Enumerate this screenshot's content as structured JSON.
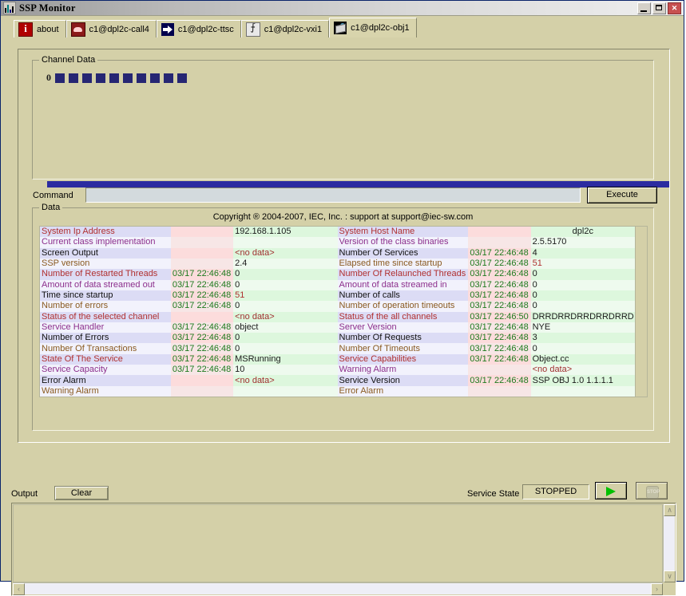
{
  "window": {
    "title": "SSP Monitor",
    "icon": "chart-bars-icon",
    "minimize_label": "",
    "maximize_label": "",
    "close_label": "✕"
  },
  "tabs": [
    {
      "label": "about",
      "icon": "info-icon"
    },
    {
      "label": "c1@dpl2c-call4",
      "icon": "call-icon"
    },
    {
      "label": "c1@dpl2c-ttsc",
      "icon": "arrow-right-icon"
    },
    {
      "label": "c1@dpl2c-vxi1",
      "icon": "vxi-icon"
    },
    {
      "label": "c1@dpl2c-obj1",
      "icon": "object-icon"
    }
  ],
  "selected_tab_index": 4,
  "channel_data": {
    "group_title": "Channel Data",
    "index_label": "0",
    "channel_count": 10,
    "channel_color": "#262673"
  },
  "progress": {
    "percent": 100,
    "fill_color": "#2b2ba0"
  },
  "command": {
    "label": "Command",
    "value": "",
    "placeholder": "",
    "execute_label": "Execute"
  },
  "data_panel": {
    "group_title": "Data",
    "copyright": "Copyright ® 2004-2007, IEC, Inc. : support at support@iec-sw.com"
  },
  "table": {
    "left_rows": [
      {
        "label": "System Ip Address",
        "time": "",
        "value": "192.168.1.105"
      },
      {
        "label": "Current class implementation",
        "time": "",
        "value": ""
      },
      {
        "label": "Screen Output",
        "time": "",
        "value": "<no data>"
      },
      {
        "label": "SSP version",
        "time": "",
        "value": "2.4"
      },
      {
        "label": "Number of Restarted Threads",
        "time": "03/17 22:46:48",
        "value": "0"
      },
      {
        "label": "Amount of data streamed out",
        "time": "03/17 22:46:48",
        "value": "0"
      },
      {
        "label": "Time since startup",
        "time": "03/17 22:46:48",
        "value": "51"
      },
      {
        "label": "Number of errors",
        "time": "03/17 22:46:48",
        "value": "0"
      },
      {
        "label": "Status of the selected channel",
        "time": "",
        "value": "<no data>"
      },
      {
        "label": "Service Handler",
        "time": "03/17 22:46:48",
        "value": "object"
      },
      {
        "label": "Number of Errors",
        "time": "03/17 22:46:48",
        "value": "0"
      },
      {
        "label": "Number Of Transactions",
        "time": "03/17 22:46:48",
        "value": "0"
      },
      {
        "label": "State Of The Service",
        "time": "03/17 22:46:48",
        "value": "MSRunning"
      },
      {
        "label": "Service Capacity",
        "time": "03/17 22:46:48",
        "value": "10"
      },
      {
        "label": "Error Alarm",
        "time": "",
        "value": "<no data>"
      },
      {
        "label": "Warning Alarm",
        "time": "",
        "value": ""
      }
    ],
    "right_rows": [
      {
        "label": "System Host Name",
        "time": "",
        "value": "dpl2c"
      },
      {
        "label": "Version of the class binaries",
        "time": "",
        "value": "2.5.5170"
      },
      {
        "label": "Number Of Services",
        "time": "03/17 22:46:48",
        "value": "4"
      },
      {
        "label": "Elapsed time since startup",
        "time": "03/17 22:46:48",
        "value": "51"
      },
      {
        "label": "Number Of Relaunched Threads",
        "time": "03/17 22:46:48",
        "value": "0"
      },
      {
        "label": "Amount of data streamed in",
        "time": "03/17 22:46:48",
        "value": "0"
      },
      {
        "label": "Number of calls",
        "time": "03/17 22:46:48",
        "value": "0"
      },
      {
        "label": "Number of operation timeouts",
        "time": "03/17 22:46:48",
        "value": "0"
      },
      {
        "label": "Status of the all channels",
        "time": "03/17 22:46:50",
        "value": "DRRDRRDRRDRRDRRD"
      },
      {
        "label": "Server Version",
        "time": "03/17 22:46:48",
        "value": "NYE"
      },
      {
        "label": "Number Of Requests",
        "time": "03/17 22:46:48",
        "value": "3"
      },
      {
        "label": "Number Of Timeouts",
        "time": "03/17 22:46:48",
        "value": "0"
      },
      {
        "label": "Service Capabilities",
        "time": "03/17 22:46:48",
        "value": "Object.cc"
      },
      {
        "label": "Warning Alarm",
        "time": "",
        "value": "<no data>"
      },
      {
        "label": "Service Version",
        "time": "03/17 22:46:48",
        "value": "SSP OBJ 1.0    1.1.1.1"
      },
      {
        "label": "Error Alarm",
        "time": "",
        "value": ""
      }
    ]
  },
  "bottom": {
    "output_label": "Output",
    "clear_label": "Clear",
    "service_state_label": "Service State",
    "service_state_value": "STOPPED",
    "start_icon": "play-icon",
    "stop_icon": "stop-icon",
    "output_text": "",
    "scroll_up": "∧",
    "scroll_down": "∨",
    "scroll_left": "‹",
    "scroll_right": "›"
  }
}
